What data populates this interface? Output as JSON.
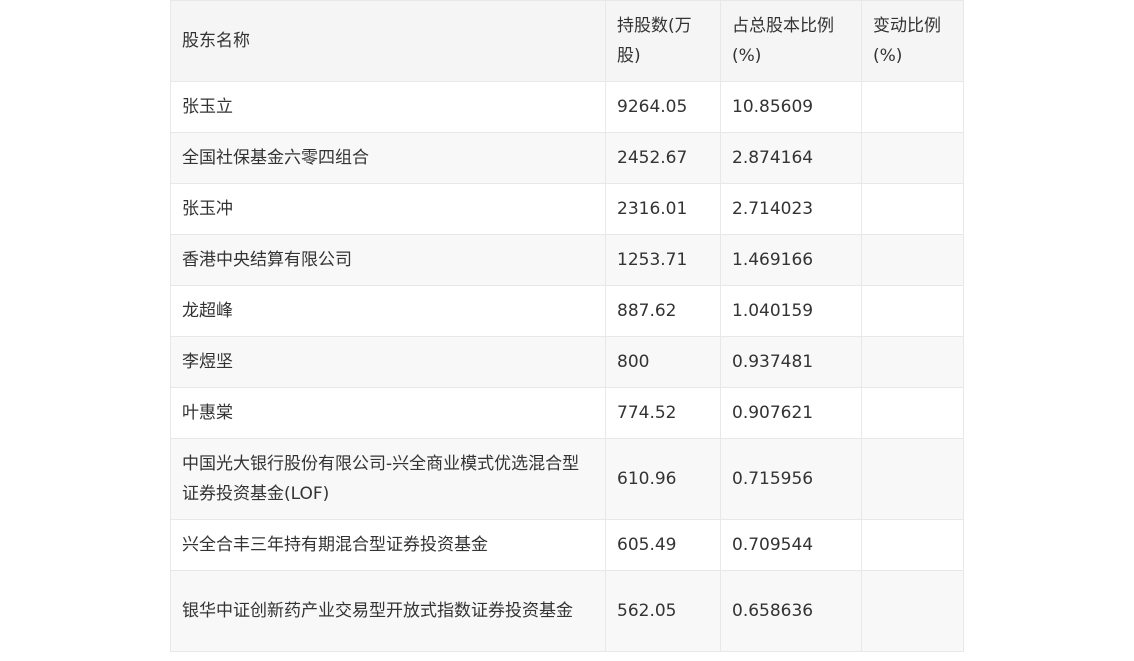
{
  "table": {
    "headers": [
      "股东名称",
      "持股数(万股)",
      "占总股本比例(%)",
      "变动比例(%)"
    ],
    "rows": [
      [
        "张玉立",
        "9264.05",
        "10.85609",
        ""
      ],
      [
        "全国社保基金六零四组合",
        "2452.67",
        "2.874164",
        ""
      ],
      [
        "张玉冲",
        "2316.01",
        "2.714023",
        ""
      ],
      [
        "香港中央结算有限公司",
        "1253.71",
        "1.469166",
        ""
      ],
      [
        "龙超峰",
        "887.62",
        "1.040159",
        ""
      ],
      [
        "李煜坚",
        "800",
        "0.937481",
        ""
      ],
      [
        "叶惠棠",
        "774.52",
        "0.907621",
        ""
      ],
      [
        "中国光大银行股份有限公司-兴全商业模式优选混合型证券投资基金(LOF)",
        "610.96",
        "0.715956",
        ""
      ],
      [
        "兴全合丰三年持有期混合型证券投资基金",
        "605.49",
        "0.709544",
        ""
      ],
      [
        "银华中证创新药产业交易型开放式指数证券投资基金",
        "562.05",
        "0.658636",
        ""
      ]
    ]
  }
}
